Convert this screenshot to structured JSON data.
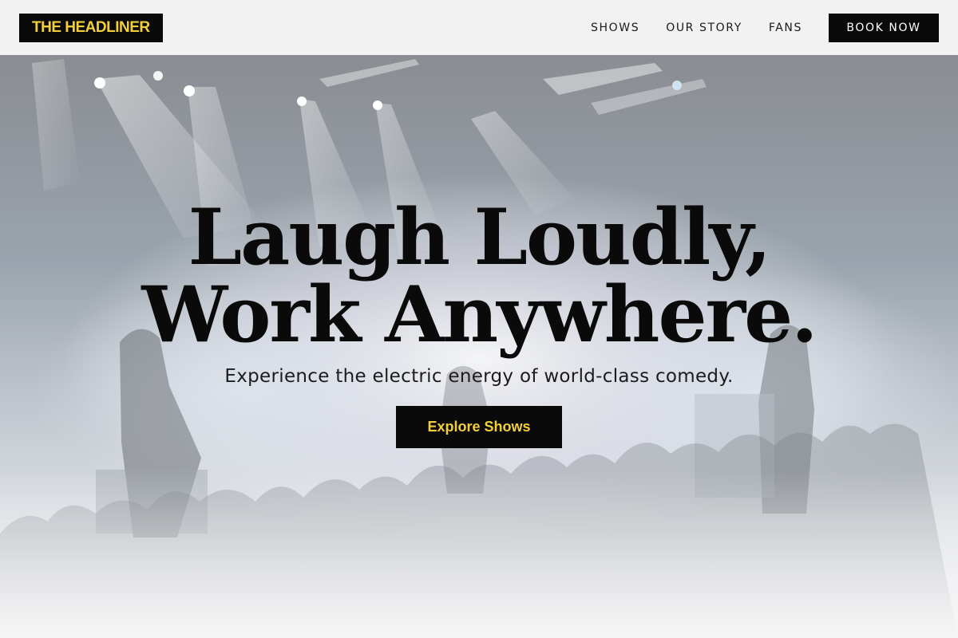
{
  "brand": {
    "logo_text": "THE HEADLINER",
    "logo_color": "#f2cf3a",
    "logo_bg": "#0a0a0a"
  },
  "nav": {
    "links": [
      "SHOWS",
      "OUR STORY",
      "FANS"
    ],
    "cta_label": "BOOK NOW"
  },
  "hero": {
    "headline_line1": "Laugh Loudly,",
    "headline_line2": "Work Anywhere.",
    "subheadline": "Experience the electric energy of world-class comedy.",
    "cta_label": "Explore Shows",
    "background": "concert-stage-photo",
    "accent_color": "#f2cf3a"
  }
}
